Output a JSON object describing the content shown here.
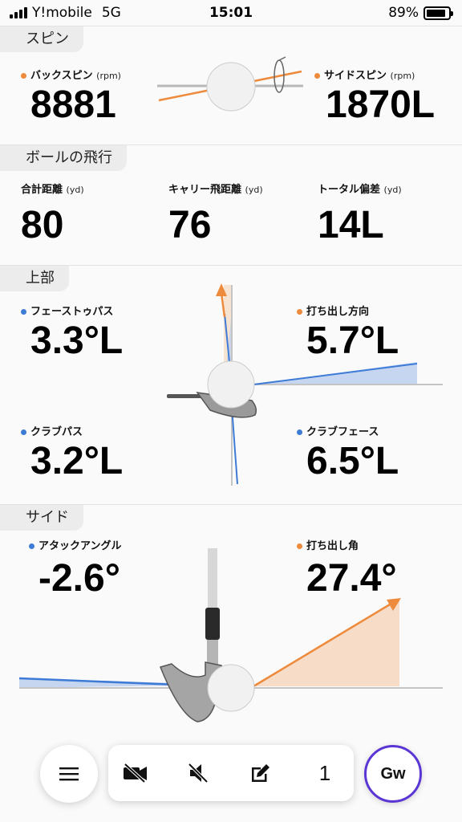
{
  "status_bar": {
    "carrier": "Y!mobile",
    "network": "5G",
    "time": "15:01",
    "battery": "89%"
  },
  "spin": {
    "title": "スピン",
    "backspin_label": "バックスピン",
    "backspin_unit": "(rpm)",
    "backspin_value": "8881",
    "sidespin_label": "サイドスピン",
    "sidespin_unit": "(rpm)",
    "sidespin_value": "1870L"
  },
  "flight": {
    "title": "ボールの飛行",
    "total_label": "合計距離",
    "total_unit": "(yd)",
    "total_value": "80",
    "carry_label": "キャリー飛距離",
    "carry_unit": "(yd)",
    "carry_value": "76",
    "offline_label": "トータル偏差",
    "offline_unit": "(yd)",
    "offline_value": "14L"
  },
  "top": {
    "title": "上部",
    "face_to_path_label": "フェーストゥパス",
    "face_to_path_value": "3.3°L",
    "launch_dir_label": "打ち出し方向",
    "launch_dir_value": "5.7°L",
    "club_path_label": "クラブパス",
    "club_path_value": "3.2°L",
    "club_face_label": "クラブフェース",
    "club_face_value": "6.5°L"
  },
  "side": {
    "title": "サイド",
    "attack_label": "アタックアングル",
    "attack_value": "-2.6°",
    "launch_angle_label": "打ち出し角",
    "launch_angle_value": "27.4°"
  },
  "toolbar": {
    "shot_number": "1",
    "club": "Gw"
  },
  "colors": {
    "orange": "#ee8a3c",
    "blue": "#3e7bd6",
    "accent": "#5a36d4"
  }
}
